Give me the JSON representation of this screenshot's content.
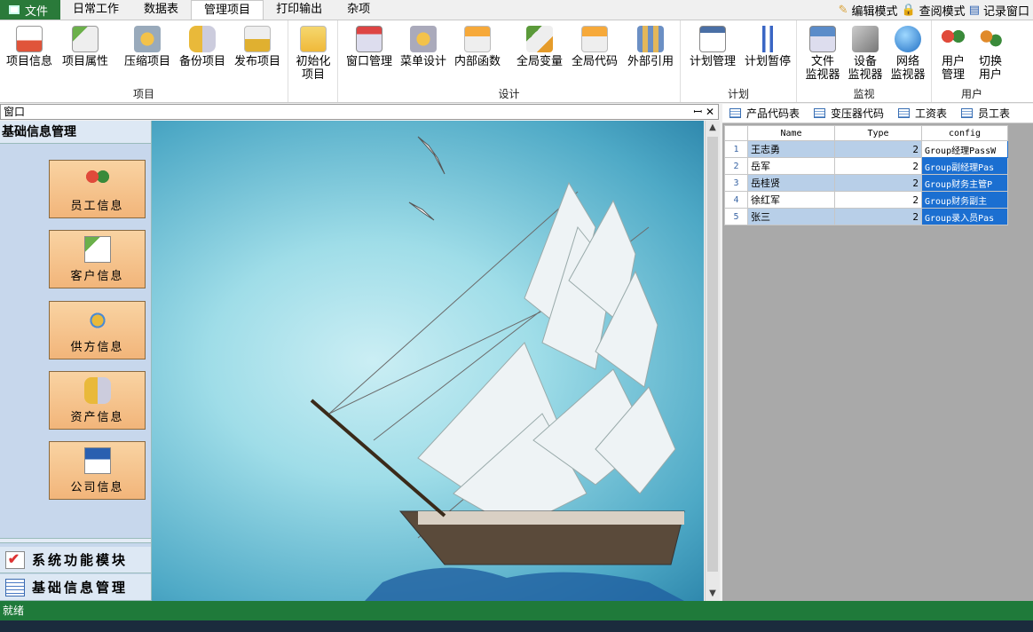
{
  "menu": {
    "file": "文件",
    "items": [
      "日常工作",
      "数据表",
      "管理项目",
      "打印输出",
      "杂项"
    ],
    "active_index": 2,
    "right": [
      "编辑模式",
      "查阅模式",
      "记录窗口"
    ]
  },
  "ribbon": {
    "groups": [
      {
        "label": "项目",
        "buttons": [
          "项目信息",
          "项目属性",
          "压缩项目",
          "备份项目",
          "发布项目"
        ]
      },
      {
        "label": "",
        "buttons": [
          "初始化\n项目"
        ]
      },
      {
        "label": "设计",
        "buttons": [
          "窗口管理",
          "菜单设计",
          "内部函数",
          "全局变量",
          "全局代码",
          "外部引用"
        ]
      },
      {
        "label": "计划",
        "buttons": [
          "计划管理",
          "计划暂停"
        ]
      },
      {
        "label": "监视",
        "buttons": [
          "文件\n监视器",
          "设备\n监视器",
          "网络\n监视器"
        ]
      },
      {
        "label": "用户",
        "buttons": [
          "用户\n管理",
          "切换\n用户"
        ]
      }
    ]
  },
  "dock": {
    "title": "窗口",
    "pin": "ꟷ ✕"
  },
  "left_panel": {
    "header": "基础信息管理",
    "cards": [
      "员工信息",
      "客户信息",
      "供方信息",
      "资产信息",
      "公司信息"
    ],
    "nav": [
      "系统功能模块",
      "基础信息管理"
    ]
  },
  "right_tabs": [
    "产品代码表",
    "变压器代码",
    "工资表",
    "员工表"
  ],
  "table": {
    "columns": [
      "Name",
      "Type",
      "config"
    ],
    "rows": [
      {
        "n": "1",
        "name": "王志勇",
        "type": "2",
        "config": "Group经理PassW"
      },
      {
        "n": "2",
        "name": "岳军",
        "type": "2",
        "config": "Group副经理Pas"
      },
      {
        "n": "3",
        "name": "岳桂贤",
        "type": "2",
        "config": "Group财务主管P"
      },
      {
        "n": "4",
        "name": "徐红军",
        "type": "2",
        "config": "Group财务副主"
      },
      {
        "n": "5",
        "name": "张三",
        "type": "2",
        "config": "Group录入员Pas"
      }
    ]
  },
  "status": "就绪",
  "colors": {
    "status_bar": "#1f7a3a",
    "file_tab": "#2a7a3a",
    "selection": "#1b6fd1",
    "card": "#f2b57a"
  }
}
